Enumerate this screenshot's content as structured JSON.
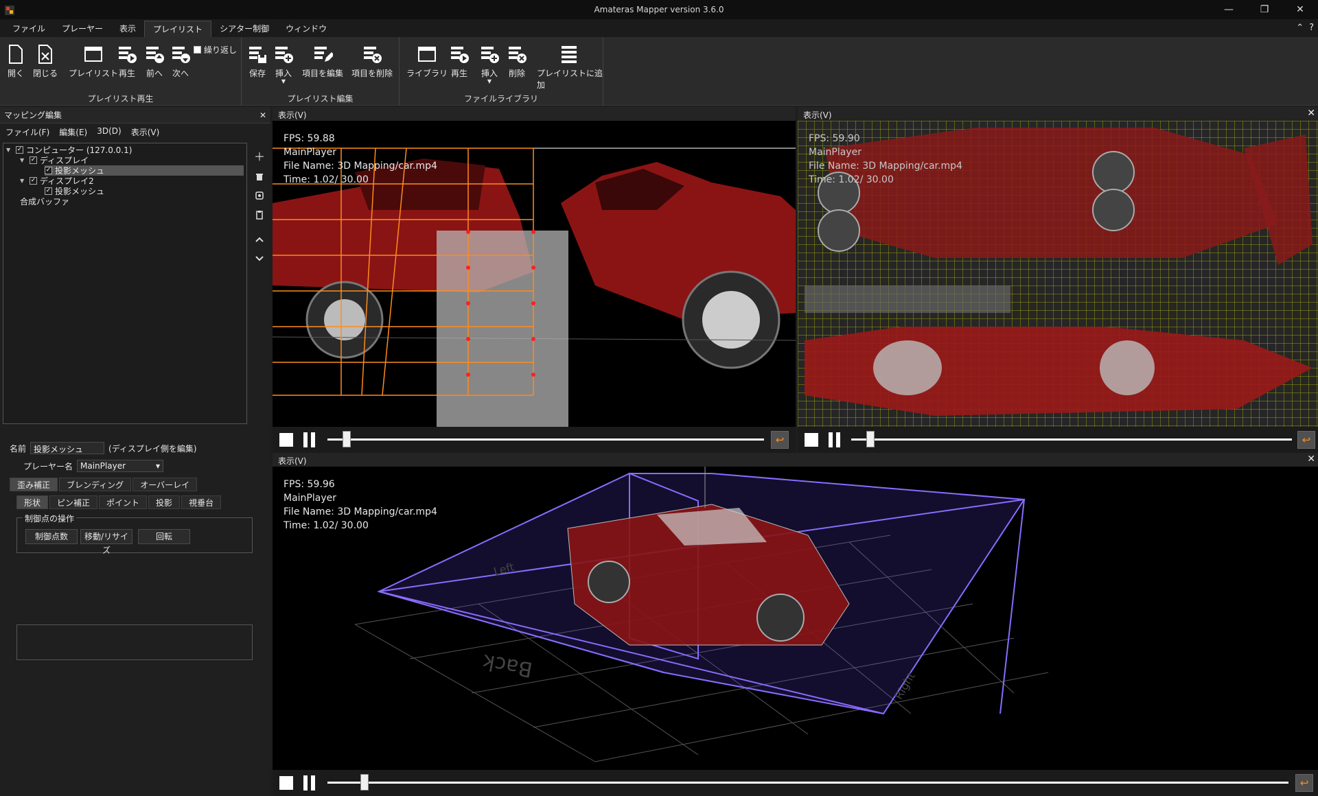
{
  "window": {
    "title": "Amateras Mapper version 3.6.0"
  },
  "menubar": {
    "items": [
      {
        "label": "ファイル",
        "active": false
      },
      {
        "label": "プレーヤー",
        "active": false
      },
      {
        "label": "表示",
        "active": false
      },
      {
        "label": "プレイリスト",
        "active": true
      },
      {
        "label": "シアター制御",
        "active": false
      },
      {
        "label": "ウィンドウ",
        "active": false
      }
    ],
    "collapse_icon": "chevron-up-icon",
    "help_icon": "help-icon"
  },
  "ribbon": {
    "groups": [
      {
        "label": "プレイリスト再生"
      },
      {
        "label": "プレイリスト編集"
      },
      {
        "label": "ファイルライブラリ"
      }
    ],
    "buttons": {
      "open": "開く",
      "close": "閉じる",
      "playlist": "プレイリスト",
      "play": "再生",
      "prev": "前へ",
      "next": "次へ",
      "repeat": "繰り返し",
      "save": "保存",
      "insert": "挿入",
      "edit_item": "項目を編集",
      "delete_item": "項目を削除",
      "library": "ライブラリ",
      "lib_play": "再生",
      "lib_insert": "挿入",
      "lib_delete": "削除",
      "add_to_playlist": "プレイリストに追加"
    }
  },
  "left": {
    "title": "マッピング編集",
    "menu": [
      "ファイル(F)",
      "編集(E)",
      "3D(D)",
      "表示(V)"
    ],
    "tree": [
      {
        "label": "コンピューター (127.0.0.1)",
        "checked": true
      },
      {
        "label": "ディスプレイ",
        "checked": true
      },
      {
        "label": "投影メッシュ",
        "checked": true
      },
      {
        "label": "ディスプレイ2",
        "checked": true
      },
      {
        "label": "投影メッシュ",
        "checked": true
      },
      {
        "label": "合成バッファ"
      }
    ],
    "props": {
      "name_label": "名前",
      "name_value": "投影メッシュ",
      "name_note": "(ディスプレイ側を編集)",
      "player_label": "プレーヤー名",
      "player_value": "MainPlayer"
    },
    "tabs1": [
      "歪み補正",
      "ブレンディング",
      "オーバーレイ"
    ],
    "tabs2": [
      "形状",
      "ピン補正",
      "ポイント",
      "投影",
      "視垂台"
    ],
    "group_title": "制御点の操作",
    "group_buttons": [
      "制御点数",
      "移動/リサイズ",
      "回転"
    ]
  },
  "views": [
    {
      "title": "表示(V)",
      "fps": "FPS: 59.88",
      "player": "MainPlayer",
      "file": "File Name: 3D Mapping/car.mp4",
      "time": "Time:    1.02/  30.00"
    },
    {
      "title": "表示(V)",
      "fps": "FPS: 59.90",
      "player": "MainPlayer",
      "file": "File Name: 3D Mapping/car.mp4",
      "time": "Time:    1.02/  30.00"
    },
    {
      "title": "表示(V)",
      "fps": "FPS: 59.96",
      "player": "MainPlayer",
      "file": "File Name: 3D Mapping/car.mp4",
      "time": "Time:    1.02/  30.00"
    }
  ],
  "scene": {
    "back_label": "Back",
    "left_label": "Left",
    "right_label": "Right"
  },
  "playback": {
    "position_fraction": 0.034
  }
}
